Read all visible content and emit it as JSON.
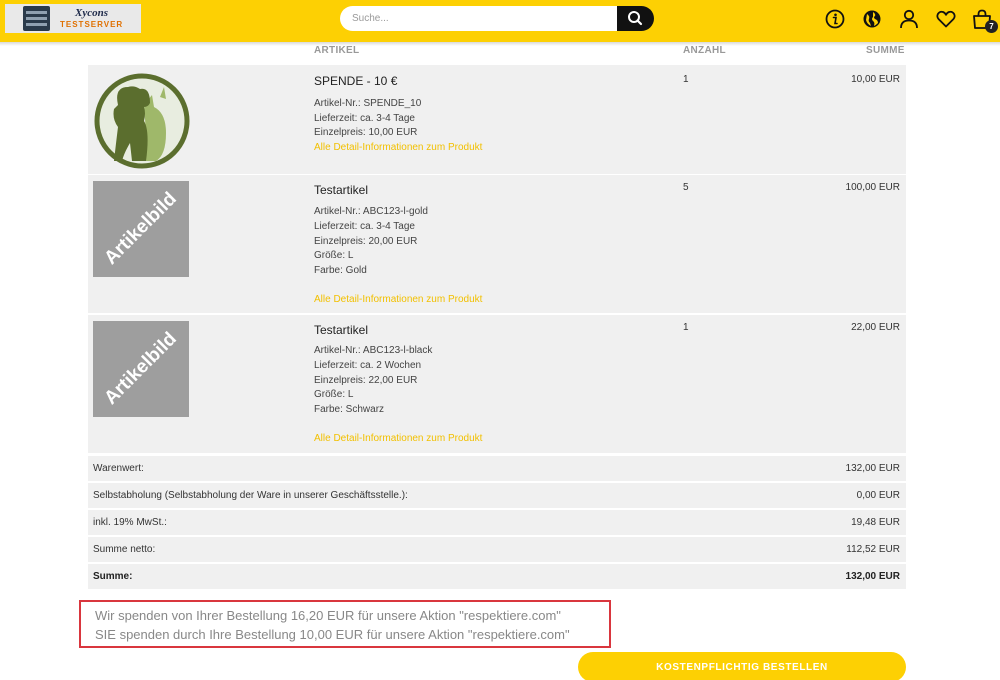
{
  "header": {
    "logo_brand": "Xycons",
    "logo_sub": "TESTSERVER",
    "search_placeholder": "Suche...",
    "cart_count": "7"
  },
  "table": {
    "col_article": "ARTIKEL",
    "col_qty": "ANZAHL",
    "col_sum": "SUMME"
  },
  "items": [
    {
      "name": "SPENDE - 10 €",
      "lines": [
        "Artikel-Nr.: SPENDE_10",
        "Lieferzeit: ca. 3-4 Tage",
        "Einzelpreis: 10,00 EUR"
      ],
      "link": "Alle Detail-Informationen zum Produkt",
      "qty": "1",
      "sum": "10,00 EUR"
    },
    {
      "name": "Testartikel",
      "image_text": "Artikelbild",
      "lines": [
        "Artikel-Nr.: ABC123-l-gold",
        "Lieferzeit: ca. 3-4 Tage",
        "Einzelpreis: 20,00 EUR",
        "Größe: L",
        "Farbe: Gold"
      ],
      "link": "Alle Detail-Informationen zum Produkt",
      "qty": "5",
      "sum": "100,00 EUR"
    },
    {
      "name": "Testartikel",
      "image_text": "Artikelbild",
      "lines": [
        "Artikel-Nr.: ABC123-l-black",
        "Lieferzeit: ca. 2 Wochen",
        "Einzelpreis: 22,00 EUR",
        "Größe: L",
        "Farbe: Schwarz"
      ],
      "link": "Alle Detail-Informationen zum Produkt",
      "qty": "1",
      "sum": "22,00 EUR"
    }
  ],
  "summary": [
    {
      "label": "Warenwert:",
      "value": "132,00 EUR"
    },
    {
      "label": "Selbstabholung (Selbstabholung der Ware in unserer Geschäftsstelle.):",
      "value": "0,00 EUR"
    },
    {
      "label": "inkl. 19% MwSt.:",
      "value": "19,48 EUR"
    },
    {
      "label": "Summe netto:",
      "value": "112,52 EUR"
    },
    {
      "label": "Summe:",
      "value": "132,00 EUR"
    }
  ],
  "donation": {
    "line1": "Wir spenden von Ihrer Bestellung 16,20 EUR für unsere Aktion \"respektiere.com\"",
    "line2": "SIE spenden durch Ihre Bestellung 10,00 EUR für unsere Aktion \"respektiere.com\""
  },
  "order_button": "KOSTENPFLICHTIG BESTELLEN",
  "colors": {
    "accent": "#fdd003",
    "link": "#f2c000",
    "row_bg": "#f0f0f0",
    "highlight_border": "#d9363e"
  },
  "icons": [
    "search-icon",
    "info-icon",
    "globe-icon",
    "user-icon",
    "heart-icon",
    "cart-icon"
  ]
}
